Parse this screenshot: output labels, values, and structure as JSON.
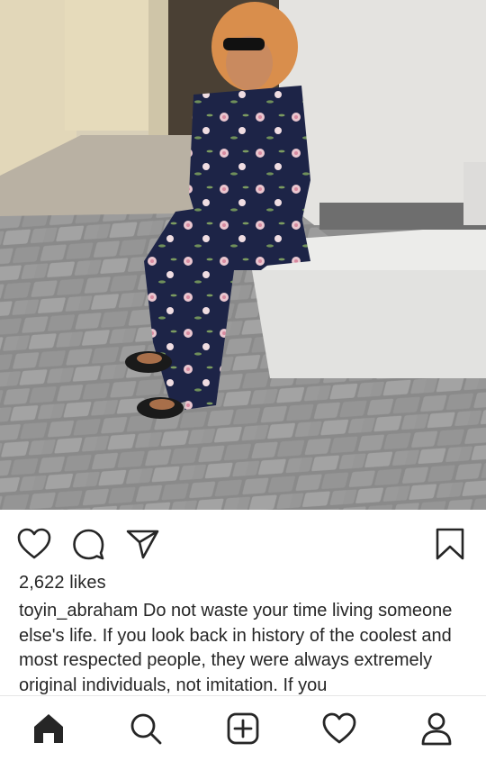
{
  "post": {
    "photo_alt": "",
    "likes_text": "2,622 likes",
    "username": "toyin_abraham",
    "caption_text": " Do not waste your time living someone else's life. If you look back in history of the coolest and most respected people, they were always extremely original individuals, not imitation. If you"
  },
  "actions": {
    "like_icon": "heart-outline-icon",
    "comment_icon": "comment-bubble-icon",
    "share_icon": "paper-plane-icon",
    "save_icon": "bookmark-icon"
  },
  "nav": {
    "items": [
      {
        "icon": "home-icon",
        "active": true
      },
      {
        "icon": "search-icon",
        "active": false
      },
      {
        "icon": "add-post-icon",
        "active": false
      },
      {
        "icon": "heart-activity-icon",
        "active": false
      },
      {
        "icon": "profile-icon",
        "active": false
      }
    ]
  },
  "colors": {
    "text": "#262626",
    "background": "#ffffff",
    "divider": "#e6e6e6"
  }
}
